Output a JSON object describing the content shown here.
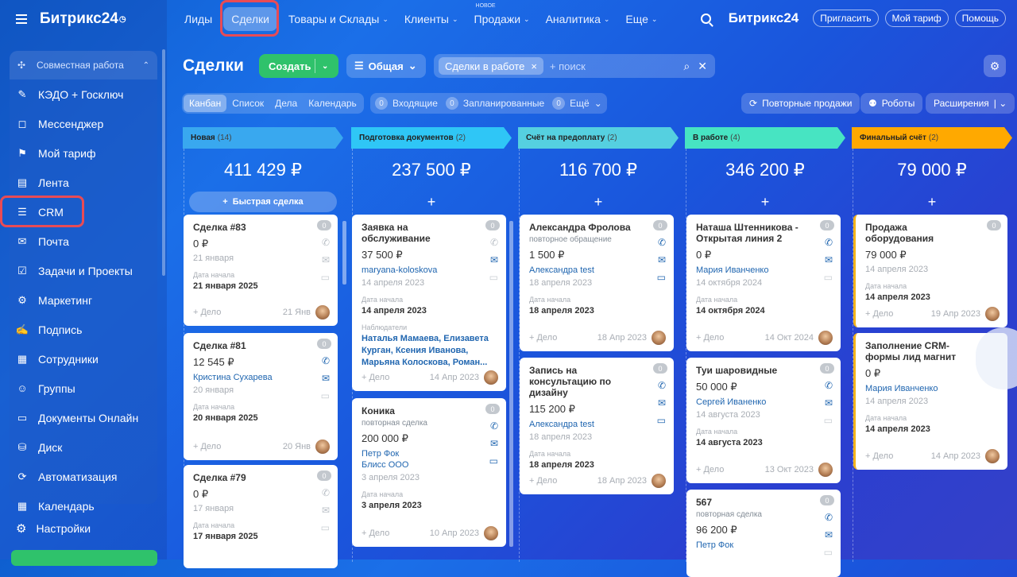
{
  "app": {
    "logo": "Битрикс24",
    "logo_mark": "◷",
    "logo2": "Битрикс24"
  },
  "topnav": [
    {
      "label": "Лиды",
      "dd": ""
    },
    {
      "label": "Сделки",
      "dd": "",
      "active": true
    },
    {
      "label": "Товары и Склады",
      "dd": "⌄"
    },
    {
      "label": "Клиенты",
      "dd": "⌄"
    },
    {
      "label": "Продажи",
      "dd": "⌄",
      "badge": "НОВОЕ"
    },
    {
      "label": "Аналитика",
      "dd": "⌄"
    },
    {
      "label": "Еще",
      "dd": "⌄"
    }
  ],
  "top_buttons": {
    "invite": "Пригласить",
    "tariff": "Мой тариф",
    "help": "Помощь"
  },
  "sidebar": {
    "section": "Совместная работа",
    "items": [
      {
        "label": "КЭДО + Госключ",
        "icon": "doc-sign-icon",
        "glyph": "✎"
      },
      {
        "label": "Мессенджер",
        "icon": "chat-icon",
        "glyph": "◻"
      },
      {
        "label": "Мой тариф",
        "icon": "tariff-icon",
        "glyph": "⚑"
      },
      {
        "label": "Лента",
        "icon": "feed-icon",
        "glyph": "▤"
      },
      {
        "label": "CRM",
        "icon": "crm-icon",
        "glyph": "☰"
      },
      {
        "label": "Почта",
        "icon": "mail-icon",
        "glyph": "✉"
      },
      {
        "label": "Задачи и Проекты",
        "icon": "tasks-icon",
        "glyph": "☑"
      },
      {
        "label": "Маркетинг",
        "icon": "marketing-icon",
        "glyph": "⚙"
      },
      {
        "label": "Подпись",
        "icon": "signature-icon",
        "glyph": "✍"
      },
      {
        "label": "Сотрудники",
        "icon": "employees-icon",
        "glyph": "▦"
      },
      {
        "label": "Группы",
        "icon": "groups-icon",
        "glyph": "☺"
      },
      {
        "label": "Документы Онлайн",
        "icon": "documents-icon",
        "glyph": "▭"
      },
      {
        "label": "Диск",
        "icon": "disk-icon",
        "glyph": "⛁"
      },
      {
        "label": "Автоматизация",
        "icon": "automation-icon",
        "glyph": "⟳"
      },
      {
        "label": "Календарь",
        "icon": "calendar-icon",
        "glyph": "▦"
      }
    ],
    "settings": "Настройки"
  },
  "toolbar": {
    "title": "Сделки",
    "create": "Создать",
    "funnel": "Общая",
    "filter_chip": "Сделки в работе",
    "search_placeholder": "+ поиск"
  },
  "views": [
    "Канбан",
    "Список",
    "Дела",
    "Календарь"
  ],
  "counters": [
    {
      "n": "0",
      "label": "Входящие"
    },
    {
      "n": "0",
      "label": "Запланированные"
    },
    {
      "n": "0",
      "label": "Ещё"
    }
  ],
  "right_buttons": {
    "repeat": "Повторные продажи",
    "robots": "Роботы",
    "ext": "Расширения"
  },
  "columns": [
    {
      "name": "Новая",
      "count": "(14)",
      "sum": "411 429 ₽",
      "color": "#39a8ef",
      "quick": "Быстрая сделка"
    },
    {
      "name": "Подготовка документов",
      "count": "(2)",
      "sum": "237 500 ₽",
      "color": "#2fc6f6",
      "quick": ""
    },
    {
      "name": "Счёт на предоплату",
      "count": "(2)",
      "sum": "116 700 ₽",
      "color": "#55d0e0",
      "quick": ""
    },
    {
      "name": "В работе",
      "count": "(4)",
      "sum": "346 200 ₽",
      "color": "#47e4c2",
      "quick": ""
    },
    {
      "name": "Финальный счёт",
      "count": "(2)",
      "sum": "79 000 ₽",
      "color": "#ffa900",
      "quick": ""
    }
  ],
  "cards": {
    "c1": {
      "title": "Сделка #83",
      "amount": "0 ₽",
      "date": "21 января",
      "lbl": "Дата начала",
      "val": "21 января 2025",
      "foot_l": "+ Дело",
      "foot_d": "21 Янв",
      "badge": "0"
    },
    "c2": {
      "title": "Сделка #81",
      "amount": "12 545 ₽",
      "link": "Кристина Сухарева",
      "date": "20 января",
      "lbl": "Дата начала",
      "val": "20 января 2025",
      "foot_l": "+ Дело",
      "foot_d": "20 Янв",
      "badge": "0"
    },
    "c3": {
      "title": "Сделка #79",
      "amount": "0 ₽",
      "date": "17 января",
      "lbl": "Дата начала",
      "val": "17 января 2025",
      "badge": "0"
    },
    "c4": {
      "title": "Заявка на обслуживание",
      "amount": "37 500 ₽",
      "link": "maryana-koloskova",
      "date": "14 апреля 2023",
      "lbl": "Дата начала",
      "val": "14 апреля 2023",
      "lbl2": "Наблюдатели",
      "obs": "Наталья Мамаева, Елизавета Курган, Ксения Иванова, Марьяна Колоскова, Роман...",
      "foot_l": "+ Дело",
      "foot_d": "14 Апр 2023",
      "badge": "0"
    },
    "c5": {
      "title": "Коника",
      "sub": "повторная сделка",
      "amount": "200 000 ₽",
      "link": "Петр Фок",
      "link2": "Блисс ООО",
      "date": "3 апреля 2023",
      "lbl": "Дата начала",
      "val": "3 апреля 2023",
      "foot_l": "+ Дело",
      "foot_d": "10 Апр 2023",
      "badge": "0"
    },
    "c6": {
      "title": "Александра Фролова",
      "sub": "повторное обращение",
      "amount": "1 500 ₽",
      "link": "Александра test",
      "date": "18 апреля 2023",
      "lbl": "Дата начала",
      "val": "18 апреля 2023",
      "foot_l": "+ Дело",
      "foot_d": "18 Апр 2023",
      "badge": "0"
    },
    "c7": {
      "title": "Запись на консультацию по дизайну",
      "amount": "115 200 ₽",
      "link": "Александра test",
      "date": "18 апреля 2023",
      "lbl": "Дата начала",
      "val": "18 апреля 2023",
      "foot_l": "+ Дело",
      "foot_d": "18 Апр 2023",
      "badge": "0"
    },
    "c8": {
      "title": "Наташа Штенникова - Открытая линия 2",
      "amount": "0 ₽",
      "link": "Мария Иванченко",
      "date": "14 октября 2024",
      "lbl": "Дата начала",
      "val": "14 октября 2024",
      "foot_l": "+ Дело",
      "foot_d": "14 Окт 2024",
      "badge": "0"
    },
    "c9": {
      "title": "Туи шаровидные",
      "amount": "50 000 ₽",
      "link": "Сергей Иваненко",
      "date": "14 августа 2023",
      "lbl": "Дата начала",
      "val": "14 августа 2023",
      "foot_l": "+ Дело",
      "foot_d": "13 Окт 2023",
      "badge": "0"
    },
    "c10": {
      "title": "567",
      "sub": "повторная сделка",
      "amount": "96 200 ₽",
      "link": "Петр Фок",
      "badge": "0"
    },
    "c11": {
      "title": "Продажа оборудования",
      "amount": "79 000 ₽",
      "date": "14 апреля 2023",
      "lbl": "Дата начала",
      "val": "14 апреля 2023",
      "foot_l": "+ Дело",
      "foot_d": "19 Апр 2023",
      "badge": "0"
    },
    "c12": {
      "title": "Заполнение CRM-формы лид магнит",
      "amount": "0 ₽",
      "link": "Мария Иванченко",
      "date": "14 апреля 2023",
      "lbl": "Дата начала",
      "val": "14 апреля 2023",
      "foot_l": "+ Дело",
      "foot_d": "14 Апр 2023",
      "badge": "0"
    }
  }
}
